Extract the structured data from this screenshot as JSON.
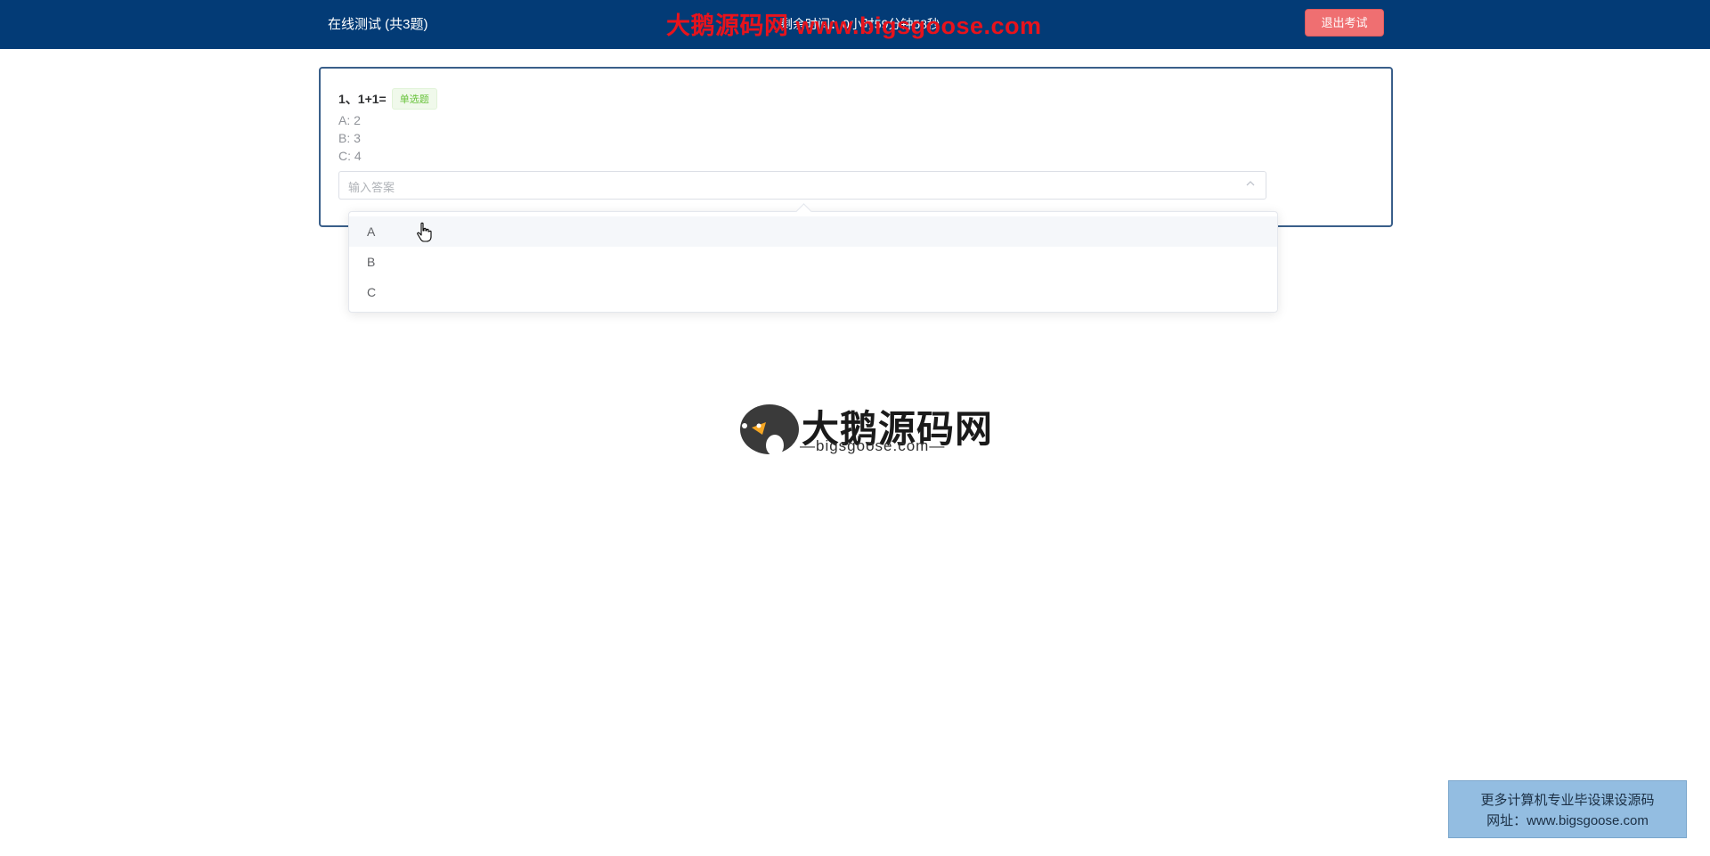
{
  "header": {
    "exam_title": "在线测试 (共3题)",
    "timer_text": "剩余时间：0小时59分钟58秒",
    "exit_label": "退出考试",
    "background": "#033b76"
  },
  "watermark_top": "大鹅源码网 www.bigsgoose.com",
  "question": {
    "text": "1、1+1=",
    "type_tag": "单选题",
    "options": [
      {
        "text": "A:  2"
      },
      {
        "text": "B:  3"
      },
      {
        "text": "C:  4"
      }
    ],
    "answer_placeholder": "输入答案"
  },
  "dropdown": {
    "items": [
      {
        "label": "A"
      },
      {
        "label": "B"
      },
      {
        "label": "C"
      }
    ],
    "hovered_index": 0
  },
  "logo": {
    "title": "大鹅源码网",
    "subtitle": "—bigsgoose.com—"
  },
  "promo": {
    "line1": "更多计算机专业毕设课设源码",
    "line2": "网址：www.bigsgoose.com"
  },
  "colors": {
    "exit_button": "#ef6f71",
    "tag_green": "#67c23a",
    "watermark_red": "#e8131c",
    "promo_bg": "#93bde1"
  }
}
